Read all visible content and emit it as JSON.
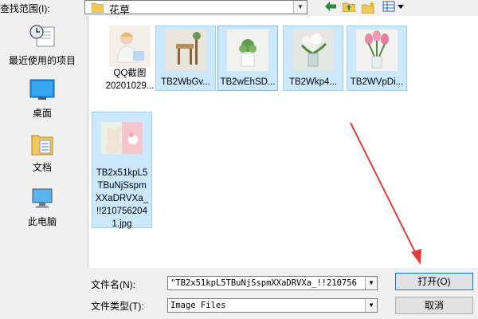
{
  "top_bar": {
    "look_in_label": "查找范围(I):",
    "look_in_value": "花草",
    "icons": [
      "back-arrow-icon",
      "up-folder-icon",
      "new-folder-icon",
      "view-menu-icon"
    ]
  },
  "places": [
    {
      "label": "最近使用的项目",
      "icon": "recent-items-icon"
    },
    {
      "label": "桌面",
      "icon": "desktop-icon"
    },
    {
      "label": "文档",
      "icon": "documents-icon"
    },
    {
      "label": "此电脑",
      "icon": "computer-icon"
    }
  ],
  "files": [
    {
      "name_lines": [
        "QQ截图",
        "202010​29..."
      ],
      "thumb": "child-photo"
    },
    {
      "name_lines": [
        "TB2WbGv..."
      ],
      "thumb": "chair-photo"
    },
    {
      "name_lines": [
        "TB2wEhSD..."
      ],
      "thumb": "plant-photo"
    },
    {
      "name_lines": [
        "TB2Wkp4..."
      ],
      "thumb": "flower-vase-photo"
    },
    {
      "name_lines": [
        "TB2WVpDi..."
      ],
      "thumb": "tulip-photo"
    },
    {
      "name_lines": [
        "TB2x51kpL5",
        "TBuNjSspm",
        "XXaDRVXa_",
        "!!210756204",
        "1.jpg"
      ],
      "thumb": "bear-photo"
    }
  ],
  "bottom": {
    "file_name_label": "文件名(N):",
    "file_name_value": "\"TB2x51kpL5TBuNjSspmXXaDRVXa_!!210756",
    "file_type_label": "文件类型(T):",
    "file_type_value": "Image Files",
    "open_button": "打开(O)",
    "cancel_button": "取消"
  },
  "colors": {
    "selection": "#cce8ff",
    "annotation_arrow": "#e23c3c",
    "default_button_border": "#0078d7"
  }
}
